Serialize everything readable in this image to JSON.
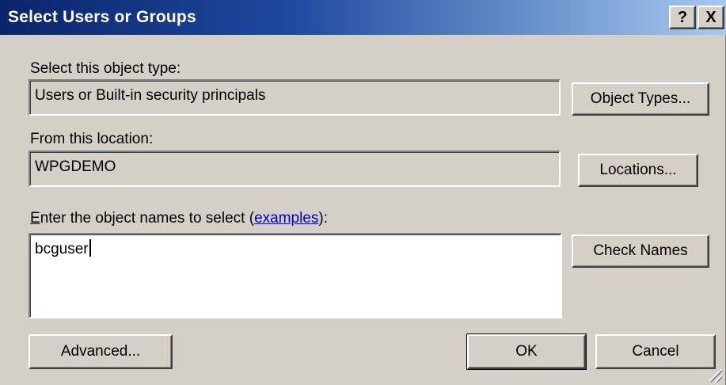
{
  "window": {
    "title": "Select Users or Groups",
    "help_glyph": "?",
    "close_glyph": "X"
  },
  "object_type": {
    "label": "Select this object type:",
    "value": "Users or Built-in security principals",
    "button_label": "Object Types..."
  },
  "location": {
    "label": "From this location:",
    "value": "WPGDEMO",
    "button_label": "Locations..."
  },
  "names": {
    "label_accel": "E",
    "label_rest": "nter the object names to select (",
    "link_text": "examples",
    "label_suffix": "):",
    "value": "bcguser",
    "check_button_label": "Check Names"
  },
  "footer": {
    "advanced_label": "Advanced...",
    "ok_label": "OK",
    "cancel_label": "Cancel"
  },
  "icons": {
    "size_grip": "resize-grip-icon"
  }
}
